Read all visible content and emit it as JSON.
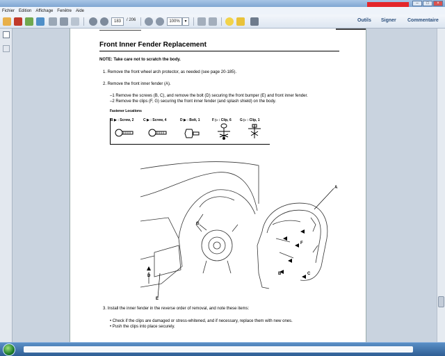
{
  "menu": [
    "Fichier",
    "Edition",
    "Affichage",
    "Fenêtre",
    "Aide"
  ],
  "toolbar": {
    "page_current": "183",
    "page_total": "/ 206",
    "zoom": "100%",
    "tools": "Outils",
    "sign": "Signer",
    "comment": "Commentaire"
  },
  "document": {
    "title": "Front Inner Fender Replacement",
    "note": "NOTE: Take care not to scratch the body.",
    "step1": "1.  Remove the front wheel arch protector, as needed (see page 20-185).",
    "step2": "2.  Remove the front inner fender (A).",
    "sub1": "–1  Remove the screws (B, C), and remove the bolt (D) securing the front bumper (E) and front inner fender.",
    "sub2": "–2  Remove the clips (F, G) securing the front inner fender (and splash shield) on the body.",
    "fastener_heading": "Fastener Locations",
    "fasteners": [
      "B ▶ : Screw, 2",
      "C ▶ : Screw, 4",
      "D ▶ : Bolt, 1",
      "F ▷ : Clip, 6",
      "G ▷ : Clip, 1"
    ],
    "step3": "3.  Install the inner fender in the reverse order of removal, and note these items:",
    "bullet1": "•  Check if the clips are damaged or stress-whitened, and if necessary, replace them with new ones.",
    "bullet2": "•  Push the clips into place securely.",
    "diagram_labels": {
      "a": "A",
      "b": "B",
      "c": "C",
      "d": "D",
      "e": "E",
      "f": "F",
      "g": "G"
    }
  },
  "colors": {
    "accent": "#2b4f7c",
    "title_red": "#e4262b",
    "taskbar": "#2f5e94"
  }
}
